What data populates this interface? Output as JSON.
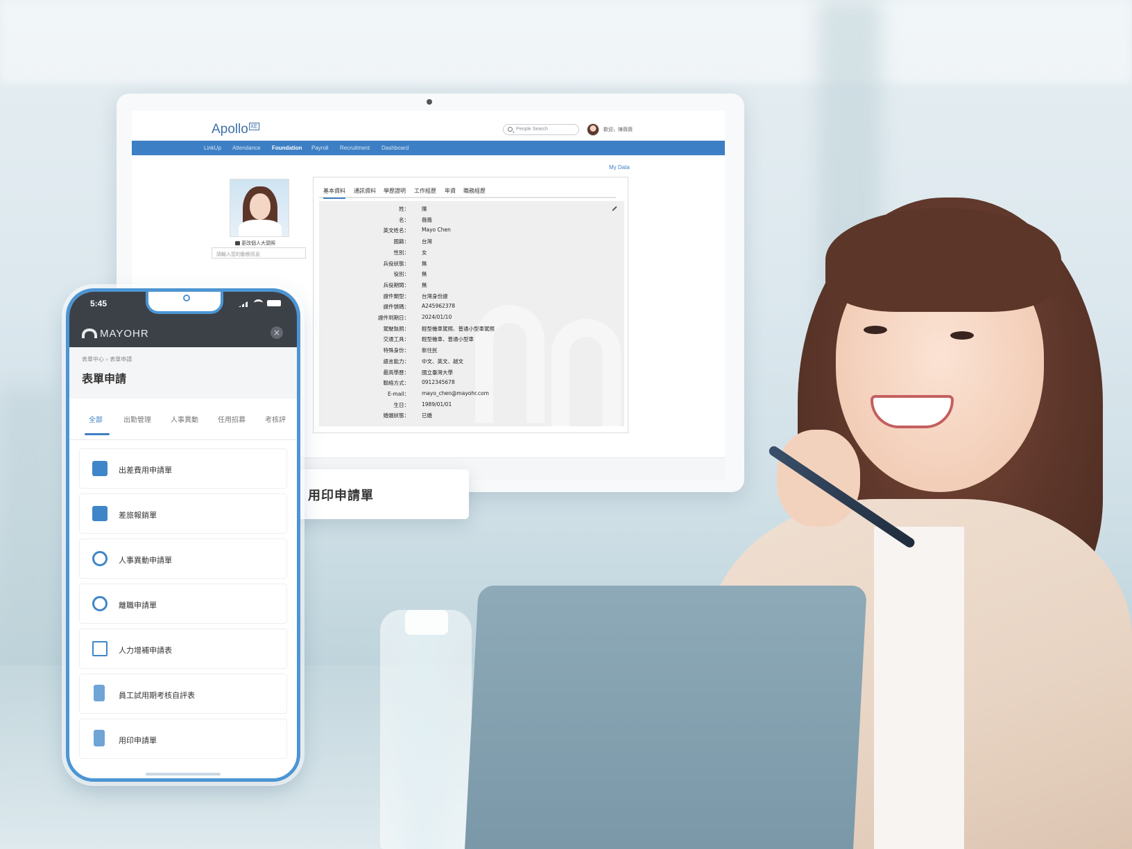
{
  "desktop": {
    "logo": "Apollo",
    "logo_badge": "XE",
    "people_search_placeholder": "People Search",
    "user_greeting": "歡迎，陳薇薇",
    "nav": [
      "LinkUp",
      "Attendance",
      "Foundation",
      "Payroll",
      "Recruitment",
      "Dashboard"
    ],
    "nav_active": "Foundation",
    "my_data": "My Data",
    "change_photo": "更改個人大頭照",
    "status_placeholder": "請輸入您的動態訊息",
    "tabs": [
      "基本資料",
      "通訊資料",
      "學歷證明",
      "工作經歷",
      "年資",
      "職務經歷"
    ],
    "fields": [
      {
        "label": "姓：",
        "value": "陳"
      },
      {
        "label": "名：",
        "value": "薇薇"
      },
      {
        "label": "英文姓名：",
        "value": "Mayo Chen"
      },
      {
        "label": "國籍：",
        "value": "台灣"
      },
      {
        "label": "性別：",
        "value": "女"
      },
      {
        "label": "兵役狀態：",
        "value": "無"
      },
      {
        "label": "役別：",
        "value": "無"
      },
      {
        "label": "兵役期間：",
        "value": "無"
      },
      {
        "label": "證件類型：",
        "value": "台灣身份證"
      },
      {
        "label": "證件號碼：",
        "value": "A245962378"
      },
      {
        "label": "證件到期日：",
        "value": "2024/01/10"
      },
      {
        "label": "駕駛執照：",
        "value": "輕型機車駕照、普通小型車駕照"
      },
      {
        "label": "交通工具：",
        "value": "輕型機車、普通小型車"
      },
      {
        "label": "特殊身份：",
        "value": "新住民"
      },
      {
        "label": "語言能力：",
        "value": "中文、英文、越文"
      },
      {
        "label": "最高學歷：",
        "value": "國立臺灣大學"
      },
      {
        "label": "聯絡方式：",
        "value": "0912345678"
      },
      {
        "label": "E-mail：",
        "value": "mayo_chen@mayohr.com"
      },
      {
        "label": "生日：",
        "value": "1989/01/01"
      },
      {
        "label": "婚姻狀態：",
        "value": "已婚"
      }
    ]
  },
  "popup": {
    "label": "用印申請單"
  },
  "phone": {
    "time": "5:45",
    "brand": "MAYOHR",
    "close_icon": "×",
    "breadcrumb": "表單中心 › 表單申請",
    "title": "表單申請",
    "tabs": [
      "全部",
      "出勤管理",
      "人事異動",
      "任用招募",
      "考核評"
    ],
    "forms": [
      {
        "label": "出差費用申請單",
        "icon": "calendar-money-icon"
      },
      {
        "label": "差旅報銷單",
        "icon": "calendar-money-icon"
      },
      {
        "label": "人事異動申請單",
        "icon": "gear-person-icon"
      },
      {
        "label": "離職申請單",
        "icon": "gear-person-icon"
      },
      {
        "label": "人力增補申請表",
        "icon": "search-person-icon"
      },
      {
        "label": "員工試用期考核自評表",
        "icon": "doc-check-icon"
      },
      {
        "label": "用印申請單",
        "icon": "doc-stamp-icon"
      }
    ]
  },
  "colors": {
    "brand_blue": "#3d7fc4",
    "phone_frame": "#4c95d4",
    "phone_header": "#3c4148"
  }
}
